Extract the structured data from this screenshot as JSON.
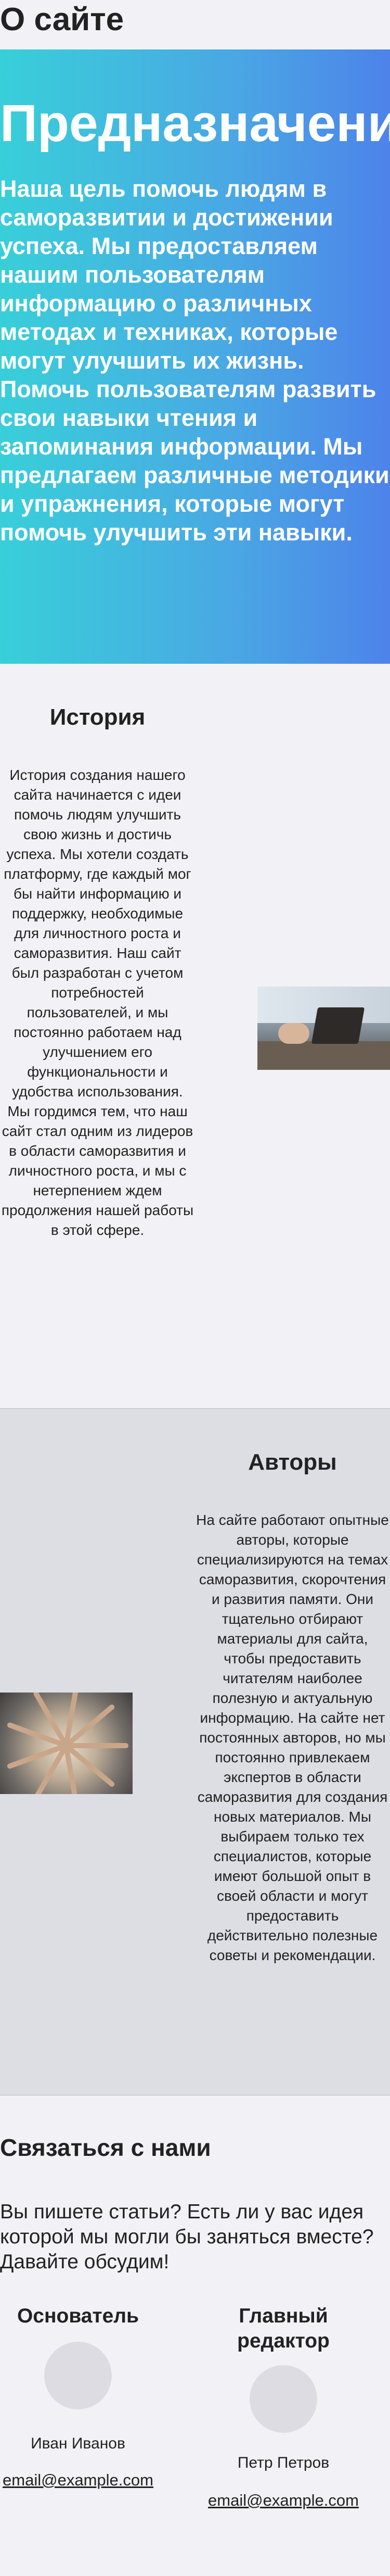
{
  "page": {
    "title": "О сайте"
  },
  "hero": {
    "title": "Предназначение",
    "text": "Наша цель помочь людям в саморазвитии и достижении успеха. Мы предоставляем нашим пользователям информацию о различных методах и техниках, которые могут улучшить их жизнь. Помочь пользователям развить свои навыки чтения и запоминания информации. Мы предлагаем различные методики и упражнения, которые могут помочь улучшить эти навыки.",
    "gradient_colors": [
      "#38cfd9",
      "#4d83ea"
    ]
  },
  "history": {
    "heading": "История",
    "text": "История создания нашего сайта начинается с идеи помочь людям улучшить свою жизнь и достичь успеха. Мы хотели создать платформу, где каждый мог бы найти информацию и поддержку, необходимые для личностного роста и саморазвития. Наш сайт был разработан с учетом потребностей пользователей, и мы постоянно работаем над улучшением его функциональности и удобства использования. Мы гордимся тем, что наш сайт стал одним из лидеров в области саморазвития и личностного роста, и мы с нетерпением ждем продолжения нашей работы в этой сфере."
  },
  "authors": {
    "heading": "Авторы",
    "text": "На сайте работают опытные авторы, которые специализируются на темах саморазвития, скорочтения и развития памяти. Они тщательно отбирают материалы для сайта, чтобы предоставить читателям наиболее полезную и актуальную информацию. На сайте нет постоянных авторов, но мы постоянно привлекаем экспертов в области саморазвития для создания новых материалов. Мы выбираем только тех специалистов, которые имеют большой опыт в своей области и могут предоставить действительно полезные советы и рекомендации."
  },
  "contact": {
    "heading": "Связаться с нами",
    "text": "Вы пишете статьи? Есть ли у вас идея которой мы могли бы заняться вместе? Давайте обсудим!",
    "people": [
      {
        "role": "Основатель",
        "name": "Иван Иванов",
        "email": "email@example.com"
      },
      {
        "role": "Главный редактор",
        "name": "Петр Петров",
        "email": "email@example.com"
      }
    ]
  }
}
